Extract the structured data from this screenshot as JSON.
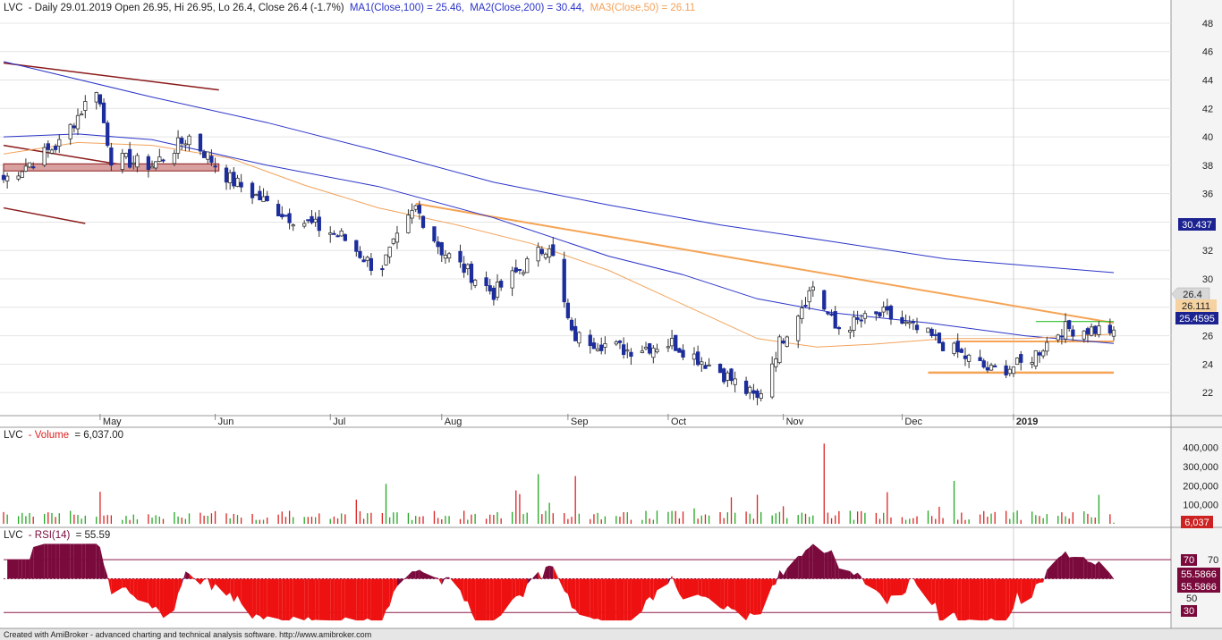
{
  "header": {
    "ticker": "LVC",
    "info": "- Daily 29.01.2019 Open 26.95, Hi 26.95, Lo 26.4, Close 26.4 (-1.7%)",
    "ma1": "MA1(Close,100) = 25.46,",
    "ma2": "MA2(Close,200) = 30.44,",
    "ma3": "MA3(Close,50) = 26.11"
  },
  "footer": "Created with AmiBroker - advanced charting and technical analysis software. http://www.amibroker.com",
  "colors": {
    "up": "#ffffff",
    "down": "#1c2d9c",
    "ma100": "#2b34c8",
    "ma200": "#2b34c8",
    "ma50": "#f2a35c",
    "trend_orange": "#f5a455",
    "trend_dark": "#8b1a1a",
    "volume_up": "#22a822",
    "volume_down": "#dd2222",
    "rsi_above": "#7a0a3c",
    "rsi_below": "#ee1111",
    "green_line": "#2ec02e"
  },
  "price_labels": {
    "close": "26.4",
    "ma50": "26.111",
    "ma100": "25.4595",
    "ma200": "30.437"
  },
  "volume_panel": {
    "title_ticker": "LVC",
    "title_name": "- Volume",
    "title_value": "= 6,037.00",
    "last_label": "6,037"
  },
  "rsi_panel": {
    "title_ticker": "LVC",
    "title_name": "- RSI(14)",
    "title_value": "= 55.59",
    "label_70": "70",
    "label_value": "55.5866",
    "label_30": "30"
  },
  "chart_data": [
    {
      "type": "candlestick",
      "title": "LVC - Daily 29.01.2019",
      "x_labels": [
        "May",
        "Jun",
        "Jul",
        "Aug",
        "Sep",
        "Oct",
        "Nov",
        "Dec",
        "2019"
      ],
      "y_ticks": [
        22,
        24,
        26,
        28,
        30,
        32,
        34,
        36,
        38,
        40,
        42,
        44,
        46,
        48
      ],
      "ylim": [
        20.5,
        48.5
      ],
      "close_path_approx": [
        {
          "date": "2018-04-05",
          "close": 37.0
        },
        {
          "date": "2018-04-20",
          "close": 39.5
        },
        {
          "date": "2018-04-30",
          "close": 43.5
        },
        {
          "date": "2018-05-04",
          "close": 38.5
        },
        {
          "date": "2018-05-15",
          "close": 38.0
        },
        {
          "date": "2018-05-25",
          "close": 40.0
        },
        {
          "date": "2018-06-05",
          "close": 37.0
        },
        {
          "date": "2018-06-20",
          "close": 34.5
        },
        {
          "date": "2018-07-05",
          "close": 33.0
        },
        {
          "date": "2018-07-15",
          "close": 30.5
        },
        {
          "date": "2018-07-25",
          "close": 35.0
        },
        {
          "date": "2018-08-01",
          "close": 32.0
        },
        {
          "date": "2018-08-15",
          "close": 29.0
        },
        {
          "date": "2018-08-30",
          "close": 32.5
        },
        {
          "date": "2018-09-05",
          "close": 26.0
        },
        {
          "date": "2018-09-20",
          "close": 25.0
        },
        {
          "date": "2018-10-02",
          "close": 25.5
        },
        {
          "date": "2018-10-15",
          "close": 23.5
        },
        {
          "date": "2018-10-25",
          "close": 21.5
        },
        {
          "date": "2018-10-31",
          "close": 25.5
        },
        {
          "date": "2018-11-09",
          "close": 29.5
        },
        {
          "date": "2018-11-15",
          "close": 26.5
        },
        {
          "date": "2018-11-28",
          "close": 27.5
        },
        {
          "date": "2018-12-10",
          "close": 26.0
        },
        {
          "date": "2018-12-20",
          "close": 24.5
        },
        {
          "date": "2018-12-27",
          "close": 23.5
        },
        {
          "date": "2019-01-05",
          "close": 24.0
        },
        {
          "date": "2019-01-15",
          "close": 26.5
        },
        {
          "date": "2019-01-29",
          "close": 26.4
        }
      ],
      "moving_averages": [
        {
          "name": "MA1(Close,100)",
          "last": 25.46
        },
        {
          "name": "MA2(Close,200)",
          "last": 30.44
        },
        {
          "name": "MA3(Close,50)",
          "last": 26.11
        }
      ],
      "horizontal_levels": [
        25.6,
        23.4,
        27.0
      ]
    },
    {
      "type": "bar",
      "title": "LVC - Volume = 6,037.00",
      "y_ticks": [
        100000,
        200000,
        300000,
        400000
      ],
      "ylim": [
        0,
        440000
      ],
      "last": 6037
    },
    {
      "type": "area",
      "title": "LVC - RSI(14) = 55.59",
      "reference_lines": [
        70,
        30
      ],
      "baseline": 55.5866,
      "last": 55.59
    }
  ]
}
